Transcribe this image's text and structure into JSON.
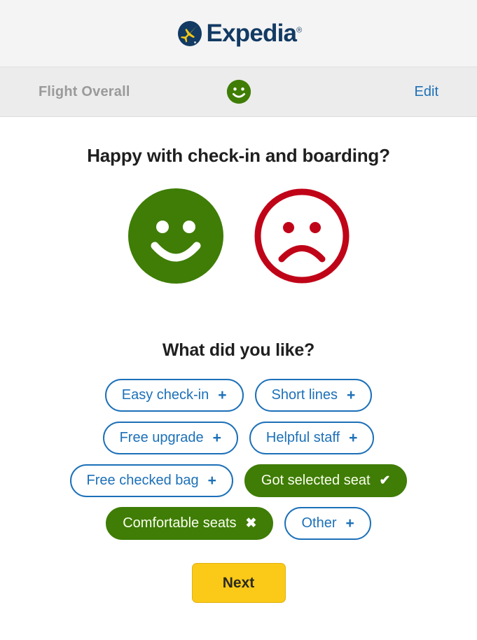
{
  "brand": {
    "name": "Expedia",
    "registered_mark": "®",
    "logo_circle_color": "#123a63",
    "logo_plane_color": "#f2c718",
    "wordmark_color": "#123a63"
  },
  "section_bar": {
    "title": "Flight Overall",
    "rating_icon": "happy-face-icon",
    "rating_color": "#3f7d06",
    "edit_label": "Edit",
    "edit_color": "#1c70b8"
  },
  "main": {
    "question": "Happy with check-in and boarding?",
    "rating_options": [
      {
        "name": "happy-face-icon",
        "label": "Happy",
        "state": "selected",
        "color": "#3f7d06",
        "style": "filled"
      },
      {
        "name": "sad-face-icon",
        "label": "Unhappy",
        "state": "unselected",
        "color": "#c00418",
        "style": "outline"
      }
    ],
    "subquestion": "What did you like?",
    "chips": [
      {
        "label": "Easy check-in",
        "icon": "+",
        "icon_name": "plus-icon",
        "selected": false
      },
      {
        "label": "Short lines",
        "icon": "+",
        "icon_name": "plus-icon",
        "selected": false
      },
      {
        "label": "Free upgrade",
        "icon": "+",
        "icon_name": "plus-icon",
        "selected": false
      },
      {
        "label": "Helpful staff",
        "icon": "+",
        "icon_name": "plus-icon",
        "selected": false
      },
      {
        "label": "Free checked bag",
        "icon": "+",
        "icon_name": "plus-icon",
        "selected": false
      },
      {
        "label": "Got selected seat",
        "icon": "✔",
        "icon_name": "check-icon",
        "selected": true
      },
      {
        "label": "Comfortable seats",
        "icon": "✖",
        "icon_name": "close-icon",
        "selected": true
      },
      {
        "label": "Other",
        "icon": "+",
        "icon_name": "plus-icon",
        "selected": false
      }
    ],
    "next_label": "Next",
    "next_color": "#fbc918"
  }
}
